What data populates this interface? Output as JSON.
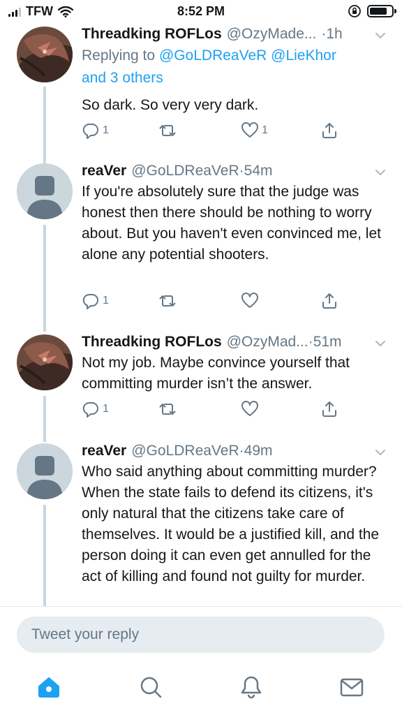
{
  "status_bar": {
    "carrier": "TFW",
    "time": "8:52 PM"
  },
  "tweets": [
    {
      "name": "Threadking ROFLos",
      "handle": "@OzyMade...",
      "time": "1h",
      "reply_prefix": "Replying to ",
      "reply_users": "@GoLDReaVeR @LieKhor",
      "reply_others": "and 3 others",
      "text": "So dark. So very very dark.",
      "replies": "1",
      "retweets": "",
      "likes": "1"
    },
    {
      "name": "reaVer",
      "handle": "@GoLDReaVeR",
      "time": "54m",
      "text": "If you're absolutely sure that the judge was honest then there should be nothing to worry about. But you haven't even convinced me, let alone any potential shooters.",
      "replies": "1",
      "retweets": "",
      "likes": ""
    },
    {
      "name": "Threadking ROFLos",
      "handle": "@OzyMad...",
      "time": "51m",
      "text": "Not my job. Maybe convince yourself that committing murder isn’t the answer.",
      "replies": "1",
      "retweets": "",
      "likes": ""
    },
    {
      "name": "reaVer",
      "handle": "@GoLDReaVeR",
      "time": "49m",
      "text": "Who said anything about committing murder? When the state fails to defend its citizens, it's only natural that the citizens take care of themselves. It would be a justified kill, and the person doing it can even get annulled for the act of killing and found not guilty for murder.",
      "replies": "",
      "retweets": "",
      "likes": ""
    }
  ],
  "reply_bar": {
    "placeholder": "Tweet your reply"
  },
  "tab_bar": {
    "tabs": [
      "home-icon",
      "search-icon",
      "notifications-icon",
      "messages-icon"
    ]
  },
  "colors": {
    "accent": "#1da1f2",
    "muted": "#657786",
    "thread_line": "#ccd6dd"
  }
}
